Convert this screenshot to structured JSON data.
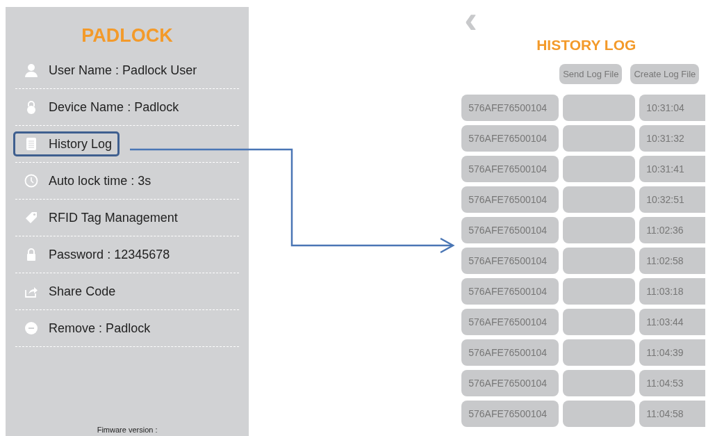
{
  "settings_panel": {
    "title": "PADLOCK",
    "items": [
      {
        "kind": "user",
        "label": "User Name : Padlock User",
        "selected": false
      },
      {
        "kind": "lockround",
        "label": "Device Name : Padlock",
        "selected": false
      },
      {
        "kind": "list",
        "label": "History Log",
        "selected": true
      },
      {
        "kind": "clock",
        "label": "Auto lock time : 3s",
        "selected": false
      },
      {
        "kind": "tag",
        "label": "RFID Tag Management",
        "selected": false
      },
      {
        "kind": "lock",
        "label": "Password : 12345678",
        "selected": false
      },
      {
        "kind": "share",
        "label": "Share Code",
        "selected": false
      },
      {
        "kind": "minus",
        "label": "Remove : Padlock",
        "selected": false
      }
    ],
    "footer": "Fimware version :"
  },
  "history_log": {
    "back": "‹",
    "title": "HISTORY LOG",
    "buttons": [
      "Send Log File",
      "Create Log File"
    ],
    "rows": [
      {
        "id": "576AFE76500104",
        "time": "10:31:04"
      },
      {
        "id": "576AFE76500104",
        "time": "10:31:32"
      },
      {
        "id": "576AFE76500104",
        "time": "10:31:41"
      },
      {
        "id": "576AFE76500104",
        "time": "10:32:51"
      },
      {
        "id": "576AFE76500104",
        "time": "11:02:36"
      },
      {
        "id": "576AFE76500104",
        "time": "11:02:58"
      },
      {
        "id": "576AFE76500104",
        "time": "11:03:18"
      },
      {
        "id": "576AFE76500104",
        "time": "11:03:44"
      },
      {
        "id": "576AFE76500104",
        "time": "11:04:39"
      },
      {
        "id": "576AFE76500104",
        "time": "11:04:53"
      },
      {
        "id": "576AFE76500104",
        "time": "11:04:58"
      }
    ]
  }
}
